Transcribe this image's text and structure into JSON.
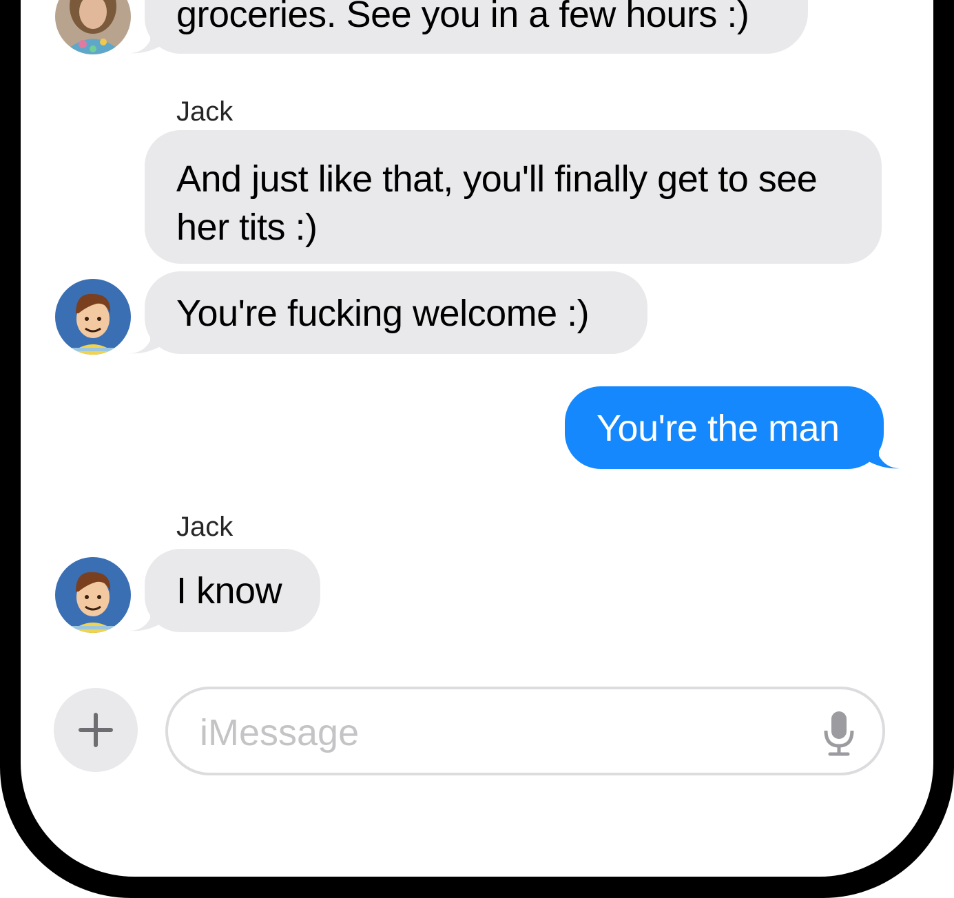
{
  "conversation": {
    "messages": [
      {
        "id": "m1",
        "direction": "incoming",
        "sender": "",
        "text": "groceries.  See you in a few hours :)"
      },
      {
        "id": "m2",
        "direction": "incoming",
        "sender": "Jack",
        "text": "And just like that, you'll finally get to see her tits :)"
      },
      {
        "id": "m3",
        "direction": "incoming",
        "sender": "",
        "text": "You're fucking welcome :)"
      },
      {
        "id": "m4",
        "direction": "outgoing",
        "sender": "",
        "text": "You're the man"
      },
      {
        "id": "m5",
        "direction": "incoming",
        "sender": "Jack",
        "text": "I know"
      }
    ]
  },
  "composer": {
    "placeholder": "iMessage",
    "plus_icon": "plus-icon",
    "mic_icon": "microphone-icon"
  },
  "colors": {
    "incoming_bubble": "#e9e9eb",
    "outgoing_bubble": "#1488fc",
    "frame": "#000000"
  }
}
